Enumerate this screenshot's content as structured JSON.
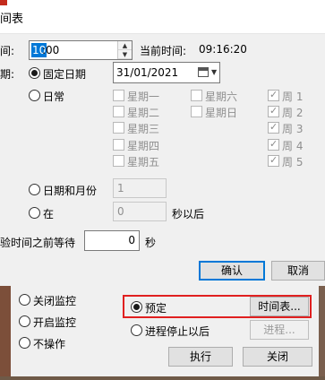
{
  "window": {
    "title": "间表"
  },
  "time": {
    "label": "间:",
    "hour": "10",
    "rest": ":00",
    "current_label": "当前时间:",
    "current_value": "09:16:20"
  },
  "period": {
    "label": "期:",
    "fixed_date_label": "固定日期",
    "date_value": "31/01/2021",
    "daily_label": "日常",
    "date_month_label": "日期和月份",
    "date_month_value": "1",
    "at_label": "在",
    "at_value": "0",
    "at_suffix": "秒以后"
  },
  "weekdays_cn": [
    "星期一",
    "星期二",
    "星期三",
    "星期四",
    "星期五",
    "星期六",
    "星期日"
  ],
  "weeks": [
    "周 1",
    "周 2",
    "周 3",
    "周 4",
    "周 5"
  ],
  "wait": {
    "label": "验时间之前等待",
    "value": "0",
    "unit": "秒"
  },
  "buttons": {
    "ok": "确认",
    "cancel": "取消"
  },
  "lower": {
    "options": [
      "关闭监控",
      "开启监控",
      "不操作"
    ],
    "scheduled_label": "预定",
    "schedule_button": "时间表...",
    "after_stop_label": "进程停止以后",
    "process_button": "进程...",
    "execute_button": "执行",
    "close_button": "关闭"
  }
}
